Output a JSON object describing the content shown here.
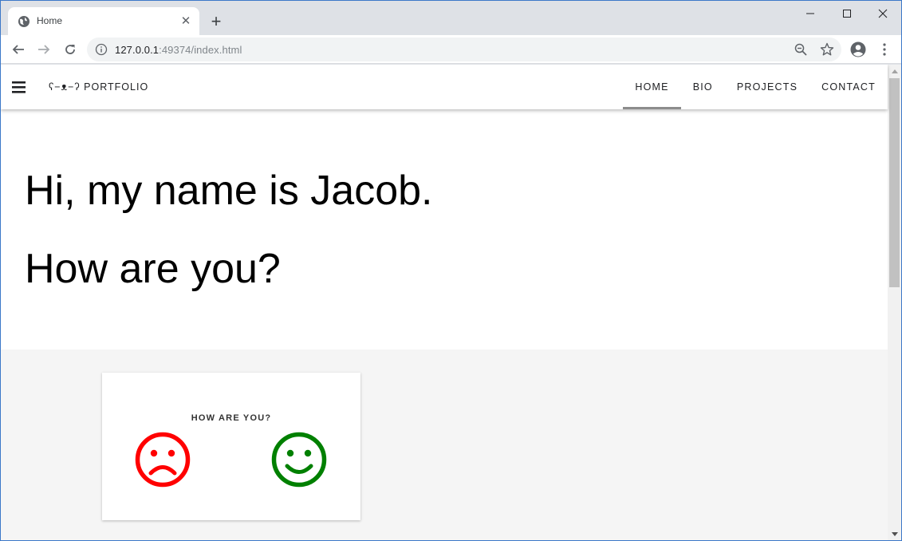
{
  "browser": {
    "tab_title": "Home",
    "url_host": "127.0.0.1",
    "url_rest": ":49374/index.html"
  },
  "appbar": {
    "brand": "ʕ−ᴥ−ʔ PORTFOLIO",
    "tabs": [
      {
        "label": "HOME",
        "active": true
      },
      {
        "label": "BIO",
        "active": false
      },
      {
        "label": "PROJECTS",
        "active": false
      },
      {
        "label": "CONTACT",
        "active": false
      }
    ]
  },
  "hero": {
    "line1": "Hi, my name is Jacob.",
    "line2": "How are you?"
  },
  "card": {
    "title": "HOW ARE YOU?",
    "sad_color": "#ff0000",
    "happy_color": "#008000"
  },
  "icons": [
    "globe-icon",
    "close-icon",
    "plus-icon",
    "minimize-icon",
    "maximize-icon",
    "back-icon",
    "forward-icon",
    "reload-icon",
    "info-icon",
    "zoom-out-icon",
    "star-icon",
    "profile-icon",
    "more-icon",
    "menu-icon",
    "sad-face-icon",
    "happy-face-icon"
  ]
}
